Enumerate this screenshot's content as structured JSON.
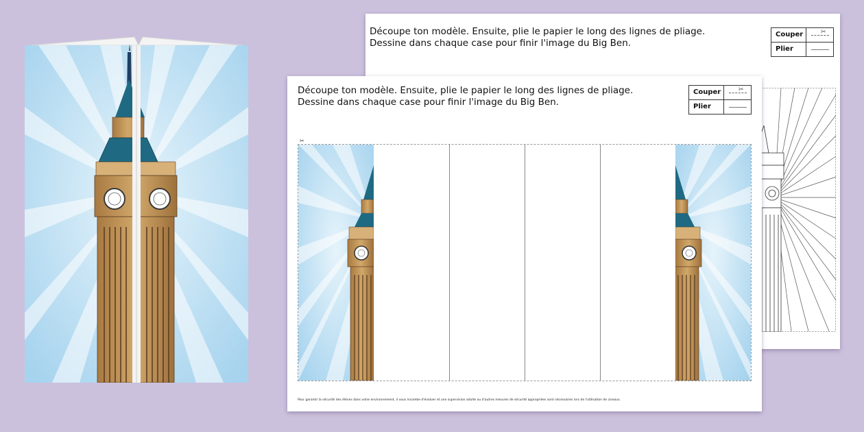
{
  "worksheet": {
    "instruction_line1": "Découpe ton modèle. Ensuite, plie le papier le long des lignes de pliage.",
    "instruction_line2": "Dessine dans chaque case pour finir l'image du Big Ben.",
    "legend": {
      "cut_label": "Couper",
      "fold_label": "Plier"
    },
    "safety_note": "Pour garantir la sécurité des élèves dans votre environnement, il vous incombe d'évaluer et une supervision adulte ou d'autres mesures de sécurité appropriées sont nécessaires lors de l'utilisation de ciseaux.",
    "scissor_glyph": "✂"
  },
  "colors": {
    "background": "#cbc1dd",
    "sky_light": "#e2f1fa",
    "sky_dark": "#9fd0ec",
    "tower_stone": "#c59a5c",
    "tower_dark": "#5b3d22",
    "roof_teal": "#1f6a82",
    "spire_navy": "#1e3f63"
  }
}
